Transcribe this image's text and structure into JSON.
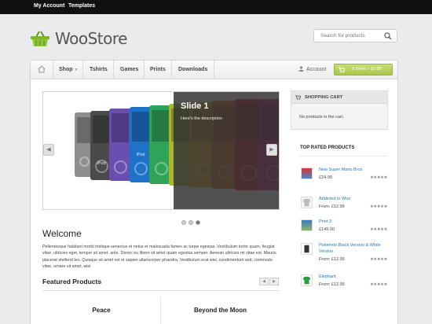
{
  "topbar": {
    "links": [
      "My Account",
      "Templates"
    ]
  },
  "brand": {
    "name": "WooStore"
  },
  "search": {
    "placeholder": "Search for products"
  },
  "nav": {
    "items": [
      "Shop",
      "Tshirts",
      "Games",
      "Prints",
      "Downloads"
    ],
    "account": "Account",
    "cart": "0 items – £0.00"
  },
  "slider": {
    "title": "Slide 1",
    "description": "Here's the description",
    "ipod_label": "iPod",
    "prev": "◀",
    "next": "▶"
  },
  "welcome": {
    "heading": "Welcome",
    "text": "Pellentesque habitant morbi tristique senectus et netus et malesuada fames ac turpis egestas. Vestibulum tortor quam, feugiat vitae, ultricies eget, tempor sit amet, ante. Donec eu libero sit amet quam egestas semper. Aenean ultricies mi vitae est. Mauris placerat eleifend leo. Quisque sit amet est et sapien ullamcorper pharetra. Vestibulum erat wisi, condimentum sed, commodo vitae, ornare sit amet, wisi."
  },
  "featured": {
    "heading": "Featured Products",
    "products": [
      "Peace",
      "Beyond the Moon"
    ]
  },
  "cart": {
    "heading": "SHOPPING CART",
    "empty": "No products in the cart."
  },
  "top_rated": {
    "heading": "TOP RATED PRODUCTS",
    "products": [
      {
        "name": "New Super Mario Bros",
        "price": "£24.99",
        "stars": "★★★★★"
      },
      {
        "name": "Addicted to Woo",
        "price": "From: £12.99",
        "stars": "★★★★★"
      },
      {
        "name": "Print 3",
        "price": "£149.00",
        "stars": "★★★★★"
      },
      {
        "name": "Pokémon Black Version & White Version",
        "price": "From: £12.99",
        "stars": "★★★★★"
      },
      {
        "name": "Elephant",
        "price": "From: £12.99",
        "stars": "★★★★★"
      }
    ]
  },
  "colors": {
    "accent": "#a9c64a",
    "link": "#2277bb",
    "topbar": "#111111"
  }
}
